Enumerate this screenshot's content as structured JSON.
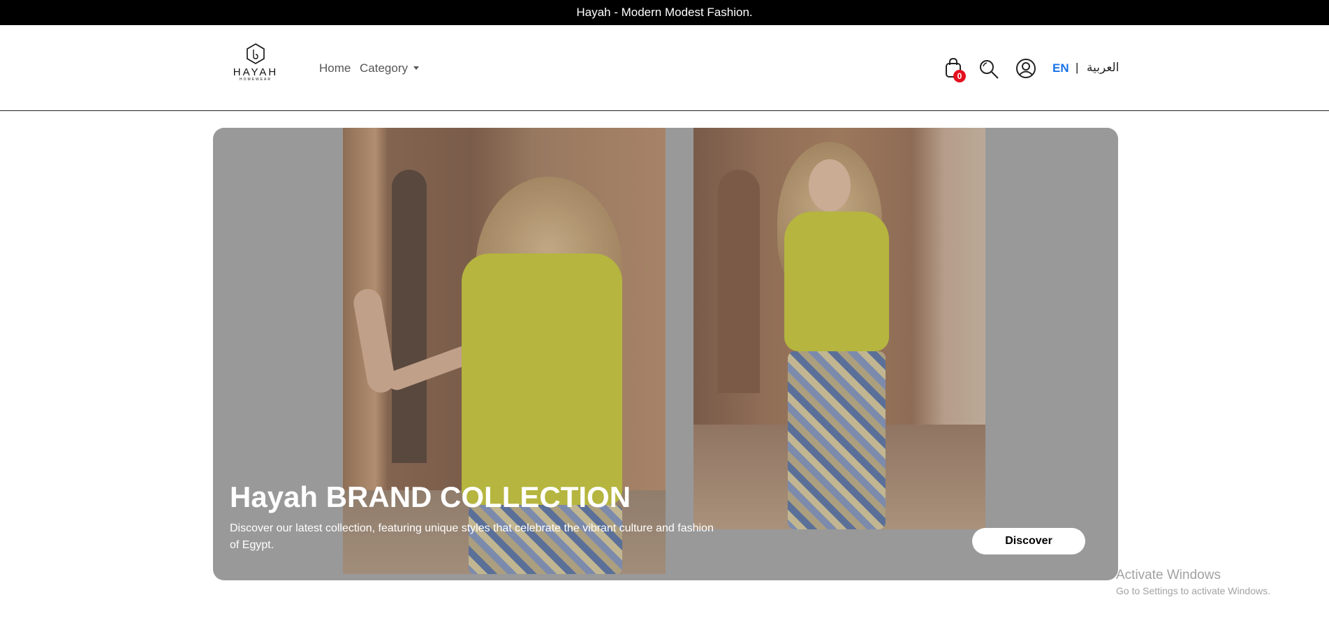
{
  "announcement": {
    "text": "Hayah - Modern Modest Fashion."
  },
  "header": {
    "logo": {
      "word": "HAYAH",
      "sub": "HOMEWEAR"
    },
    "nav": {
      "home": "Home",
      "category": "Category"
    },
    "cart": {
      "count": "0",
      "icon": "bag-icon"
    },
    "search": {
      "icon": "search-icon"
    },
    "account": {
      "icon": "user-icon"
    },
    "languages": {
      "en": "EN",
      "separator": "|",
      "ar": "العربية"
    },
    "colors": {
      "active_language": "#1a73e8",
      "badge": "#e3101e"
    }
  },
  "hero": {
    "title": "Hayah BRAND COLLECTION",
    "description": "Discover our latest collection, featuring unique styles that celebrate the vibrant culture and fashion of Egypt.",
    "button": "Discover",
    "colors": {
      "panel": "#9c9c9c",
      "text": "#ffffff"
    }
  },
  "os_watermark": {
    "title": "Activate Windows",
    "subtitle": "Go to Settings to activate Windows."
  }
}
